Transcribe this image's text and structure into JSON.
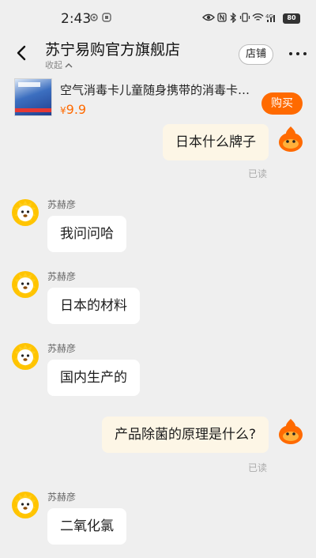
{
  "status_bar": {
    "time": "2:43",
    "network": "4G",
    "battery": "80",
    "icons": [
      "gear-icon",
      "app-icon",
      "eye-icon",
      "nfc-icon",
      "bluetooth-icon",
      "vibrate-icon",
      "wifi-icon",
      "signal-icon",
      "battery-icon"
    ]
  },
  "header": {
    "title": "苏宁易购官方旗舰店",
    "collapse_label": "收起",
    "store_button": "店铺",
    "back_icon": "chevron-left-icon",
    "more_icon": "more-dots-icon"
  },
  "product": {
    "name": "空气消毒卡儿童随身携带的消毒卡…",
    "price_symbol": "¥",
    "price": "9.9",
    "buy_button": "购买",
    "accent": "#ff6a00"
  },
  "chat": {
    "messages": [
      {
        "from": "me",
        "text": "日本什么牌子",
        "read": "已读"
      },
      {
        "from": "agent",
        "sender": "苏赫彦",
        "text": "我问问哈"
      },
      {
        "from": "agent",
        "sender": "苏赫彦",
        "text": "日本的材料"
      },
      {
        "from": "agent",
        "sender": "苏赫彦",
        "text": "国内生产的"
      },
      {
        "from": "me",
        "text": "产品除菌的原理是什么?",
        "read": "已读"
      },
      {
        "from": "agent",
        "sender": "苏赫彦",
        "text": "二氧化氯"
      }
    ]
  }
}
